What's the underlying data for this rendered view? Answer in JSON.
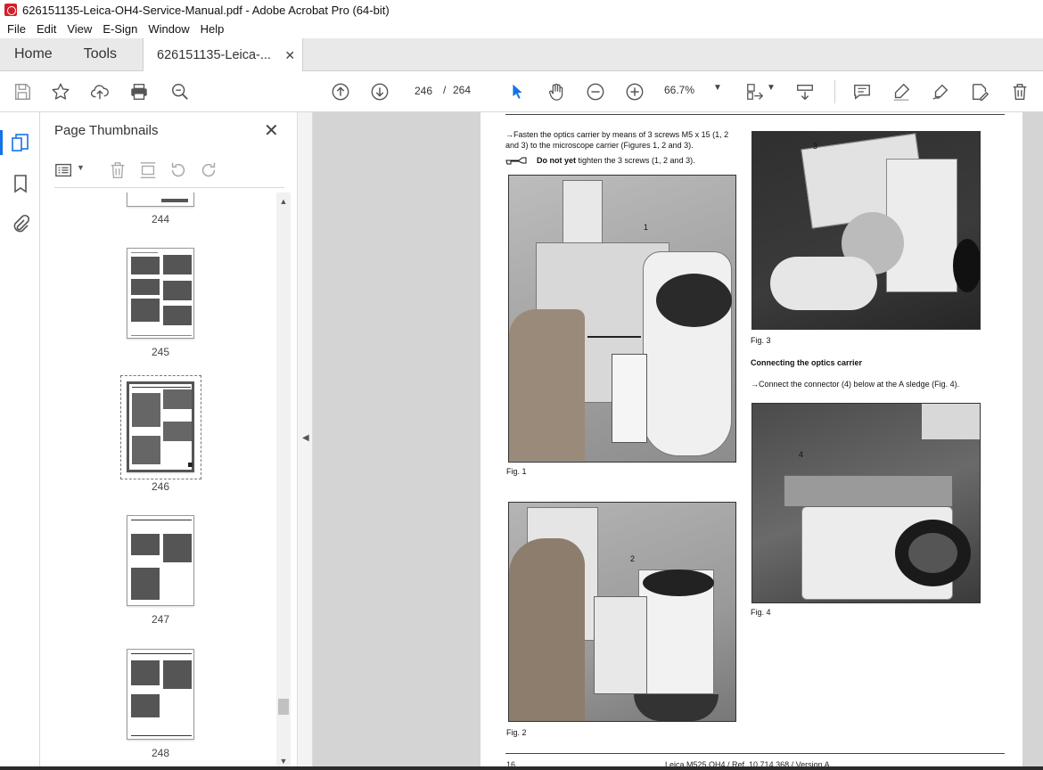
{
  "window": {
    "title": "626151135-Leica-OH4-Service-Manual.pdf - Adobe Acrobat Pro (64-bit)"
  },
  "menu": [
    "File",
    "Edit",
    "View",
    "E-Sign",
    "Window",
    "Help"
  ],
  "tabs": {
    "home": "Home",
    "tools": "Tools",
    "document": "626151135-Leica-..."
  },
  "toolbar": {
    "current_page": "246",
    "page_separator": "/",
    "total_pages": "264",
    "zoom": "66.7%"
  },
  "icons": {
    "save": "save-icon",
    "bookmark": "star-icon",
    "upload": "upload-icon",
    "print": "print-icon",
    "find": "zoom-search-icon",
    "prev": "arrow-up-icon",
    "next": "arrow-down-icon",
    "select": "pointer-icon",
    "hand": "hand-icon",
    "zoom_out": "zoom-out-icon",
    "zoom_in": "zoom-in-icon"
  },
  "thumbnails_panel": {
    "title": "Page Thumbnails",
    "pages": [
      "244",
      "245",
      "246",
      "247",
      "248"
    ],
    "selected_page": "246"
  },
  "document": {
    "instruction_1": "→Fasten the optics carrier by means of 3 screws M5 x 15 (1, 2 and 3) to the microscope carrier (Figures 1, 2 and 3).",
    "note_bold": "Do not yet",
    "note_rest": " tighten the 3 screws (1, 2 and 3).",
    "fig1_caption": "Fig. 1",
    "fig2_caption": "Fig. 2",
    "fig3_caption": "Fig. 3",
    "fig4_caption": "Fig. 4",
    "callout_1": "1",
    "callout_2": "2",
    "callout_3": "3",
    "callout_4": "4",
    "section_heading": "Connecting the optics carrier",
    "instruction_2": "→Connect the connector (4) below at the A sledge (Fig. 4).",
    "footer_page": "16",
    "footer_ref": "Leica M525 OH4 / Ref. 10 714 368 / Version A"
  }
}
